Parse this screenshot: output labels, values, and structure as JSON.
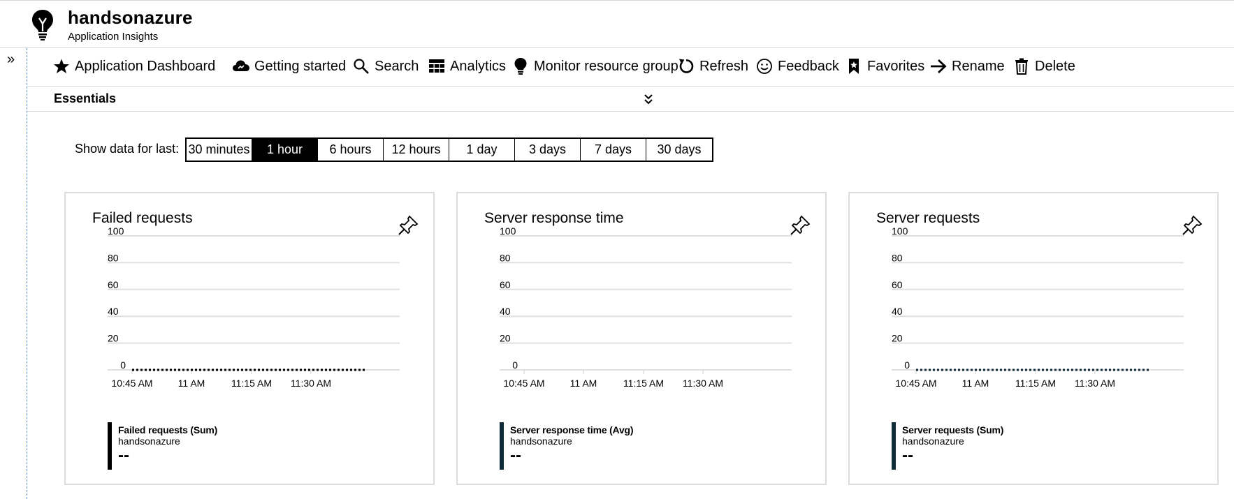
{
  "header": {
    "title": "handsonazure",
    "subtitle": "Application Insights",
    "logo_icon": "lightbulb-icon"
  },
  "left_rail": {
    "toggle_glyph": "»",
    "toggle_icon": "double-chevron-right-icon"
  },
  "toolbar": [
    {
      "label": "Application Dashboard",
      "icon": "star-icon"
    },
    {
      "label": "Getting started",
      "icon": "cloud-icon"
    },
    {
      "label": "Search",
      "icon": "search-icon"
    },
    {
      "label": "Analytics",
      "icon": "grid-icon"
    },
    {
      "label": "Monitor resource group",
      "icon": "lightbulb-icon"
    },
    {
      "label": "Refresh",
      "icon": "refresh-icon"
    },
    {
      "label": "Feedback",
      "icon": "smiley-icon"
    },
    {
      "label": "Favorites",
      "icon": "bookmark-star-icon"
    },
    {
      "label": "Rename",
      "icon": "arrow-right-icon"
    },
    {
      "label": "Delete",
      "icon": "trash-icon"
    }
  ],
  "essentials": {
    "title": "Essentials",
    "toggle_icon": "double-chevron-down-icon"
  },
  "time_range": {
    "label": "Show data for last:",
    "options": [
      "30 minutes",
      "1 hour",
      "6 hours",
      "12 hours",
      "1 day",
      "3 days",
      "7 days",
      "30 days"
    ],
    "selected": "1 hour"
  },
  "charts": [
    {
      "title": "Failed requests",
      "pin_icon": "pin-icon",
      "legend": {
        "name": "Failed requests (Sum)",
        "resource": "handsonazure",
        "value": "--",
        "color": "#000000"
      }
    },
    {
      "title": "Server response time",
      "pin_icon": "pin-icon",
      "legend": {
        "name": "Server response time (Avg)",
        "resource": "handsonazure",
        "value": "--",
        "color": "#0f2b3a"
      }
    },
    {
      "title": "Server requests",
      "pin_icon": "pin-icon",
      "legend": {
        "name": "Server requests (Sum)",
        "resource": "handsonazure",
        "value": "--",
        "color": "#0f2b3a"
      }
    }
  ],
  "chart_data": [
    {
      "type": "line",
      "title": "Failed requests",
      "y_ticks": [
        "100",
        "80",
        "60",
        "40",
        "20",
        "0"
      ],
      "ylim": [
        0,
        100
      ],
      "x_ticks": [
        "10:45 AM",
        "11 AM",
        "11:15 AM",
        "11:30 AM"
      ],
      "grid": true,
      "series": [
        {
          "name": "Failed requests (Sum)",
          "values": [
            0,
            0,
            0,
            0
          ],
          "style": "dotted"
        }
      ]
    },
    {
      "type": "line",
      "title": "Server response time",
      "y_ticks": [
        "100",
        "80",
        "60",
        "40",
        "20",
        "0"
      ],
      "ylim": [
        0,
        100
      ],
      "x_ticks": [
        "10:45 AM",
        "11 AM",
        "11:15 AM",
        "11:30 AM"
      ],
      "grid": true,
      "series": [
        {
          "name": "Server response time (Avg)",
          "values": []
        }
      ]
    },
    {
      "type": "line",
      "title": "Server requests",
      "y_ticks": [
        "100",
        "80",
        "60",
        "40",
        "20",
        "0"
      ],
      "ylim": [
        0,
        100
      ],
      "x_ticks": [
        "10:45 AM",
        "11 AM",
        "11:15 AM",
        "11:30 AM"
      ],
      "grid": true,
      "series": [
        {
          "name": "Server requests (Sum)",
          "values": [
            0,
            0,
            0,
            0
          ],
          "style": "dotted"
        }
      ]
    }
  ]
}
